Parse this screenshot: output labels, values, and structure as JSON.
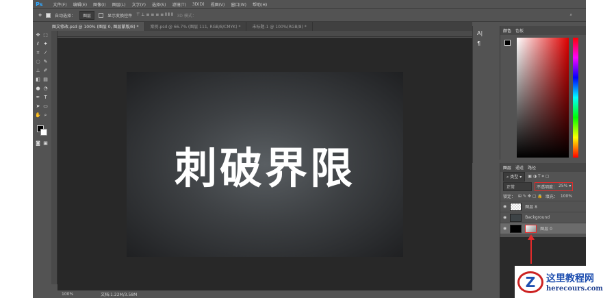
{
  "menu": {
    "logo": "Ps",
    "items": [
      "文件(F)",
      "编辑(E)",
      "图像(I)",
      "图层(L)",
      "文字(Y)",
      "选择(S)",
      "滤镜(T)",
      "3D(D)",
      "视图(V)",
      "窗口(W)",
      "帮助(H)"
    ]
  },
  "options": {
    "auto_select": "自动选择：",
    "layer_select": "图层",
    "show_transform": "显示变换控件",
    "mode_3d": "3D 模式："
  },
  "tabs": [
    "图文修改.psd @ 100% (图层 0, 图层蒙版/8) *",
    "案例.psd @ 66.7% (图层 111, RGB/8/CMYK) *",
    "未标题-1 @ 100%(RGB/8) *"
  ],
  "canvas": {
    "title": "刺破界限"
  },
  "status": {
    "zoom": "100%",
    "doc": "文档:1.22M/3.58M"
  },
  "color_panel": {
    "tabs": [
      "颜色",
      "色板"
    ]
  },
  "layers_panel": {
    "tabs": [
      "图层",
      "通道",
      "路径"
    ],
    "filter": "类型",
    "blend": "正常",
    "opacity_label": "不透明度：",
    "opacity": "25%",
    "lock_label": "锁定：",
    "fill_label": "填充：",
    "fill": "100%",
    "layers": [
      {
        "name": "图层 8"
      },
      {
        "name": "Background"
      },
      {
        "name": "图层 0"
      }
    ]
  },
  "watermark": {
    "name": "这里教程网",
    "url": "herecours.com",
    "mark": "Z"
  },
  "colors": {
    "accent": "#31a8ff",
    "highlight": "#e52b2b"
  }
}
